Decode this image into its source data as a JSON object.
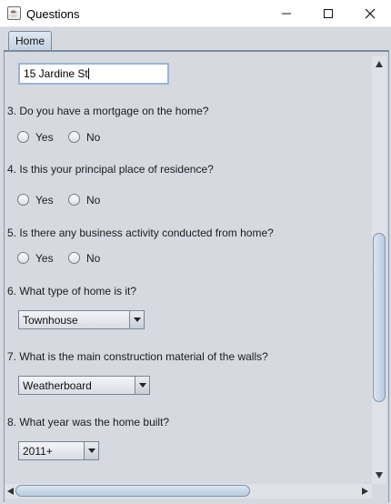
{
  "window": {
    "title": "Questions",
    "app_icon": "java-cup-icon",
    "controls": [
      "minimize-icon",
      "maximize-icon",
      "close-icon"
    ]
  },
  "tabs": [
    {
      "label": "Home",
      "selected": true
    }
  ],
  "form": {
    "address_value": "15 Jardine St",
    "q3": {
      "label": "3. Do you have a mortgage on the home?",
      "options": [
        "Yes",
        "No"
      ],
      "selected": null
    },
    "q4": {
      "label": "4. Is this your principal place of residence?",
      "options": [
        "Yes",
        "No"
      ],
      "selected": null
    },
    "q5": {
      "label": "5. Is there any business activity conducted from home?",
      "options": [
        "Yes",
        "No"
      ],
      "selected": null
    },
    "q6": {
      "label": "6. What type of home is it?",
      "selected_value": "Townhouse"
    },
    "q7": {
      "label": "7. What is the main construction material of the walls?",
      "selected_value": "Weatherboard"
    },
    "q8": {
      "label": "8. What year was the home built?",
      "selected_value": "2011+"
    }
  },
  "scrollbars": {
    "vertical": {
      "position_fraction": 0.55
    },
    "horizontal": {
      "position_fraction": 0.0
    }
  }
}
